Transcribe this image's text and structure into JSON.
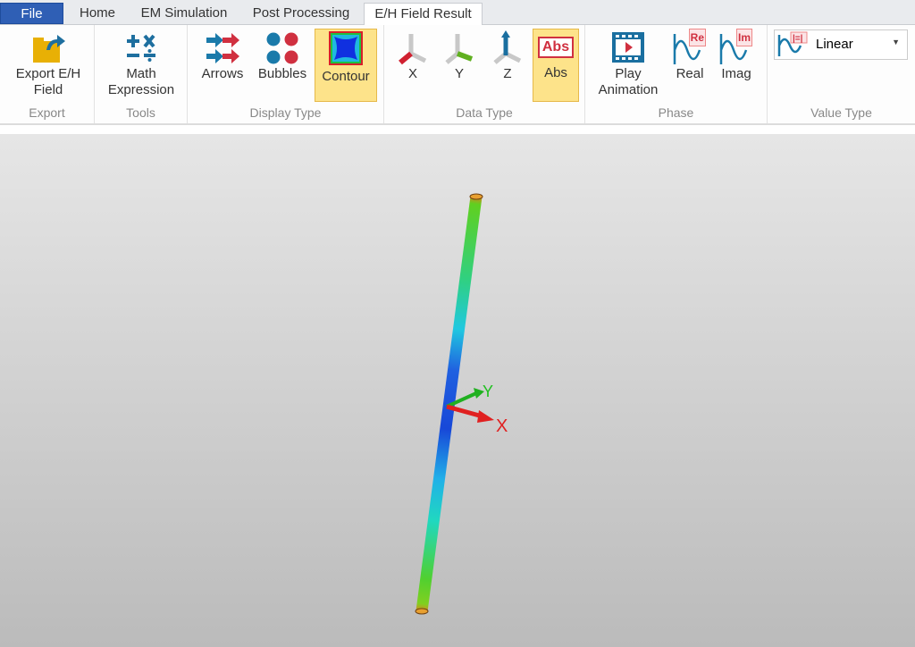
{
  "tabs": [
    "File",
    "Home",
    "EM Simulation",
    "Post Processing",
    "E/H Field Result"
  ],
  "ribbon": {
    "export": {
      "label": "Export",
      "button": [
        "Export E/H",
        "Field"
      ]
    },
    "tools": {
      "label": "Tools",
      "button": [
        "Math",
        "Expression"
      ]
    },
    "display": {
      "label": "Display Type",
      "buttons": [
        "Arrows",
        "Bubbles",
        "Contour"
      ],
      "selected": "Contour"
    },
    "data": {
      "label": "Data Type",
      "buttons": [
        "X",
        "Y",
        "Z",
        "Abs"
      ],
      "selected": "Abs",
      "abs_icon": "Abs"
    },
    "phase": {
      "label": "Phase",
      "buttons": [
        [
          "Play",
          "Animation"
        ],
        "Real",
        "Imag"
      ],
      "re_icon": "Re",
      "im_icon": "Im"
    },
    "value": {
      "label": "Value Type",
      "selected": "Linear"
    }
  },
  "viewport": {
    "axis_x": "X",
    "axis_y": "Y"
  }
}
